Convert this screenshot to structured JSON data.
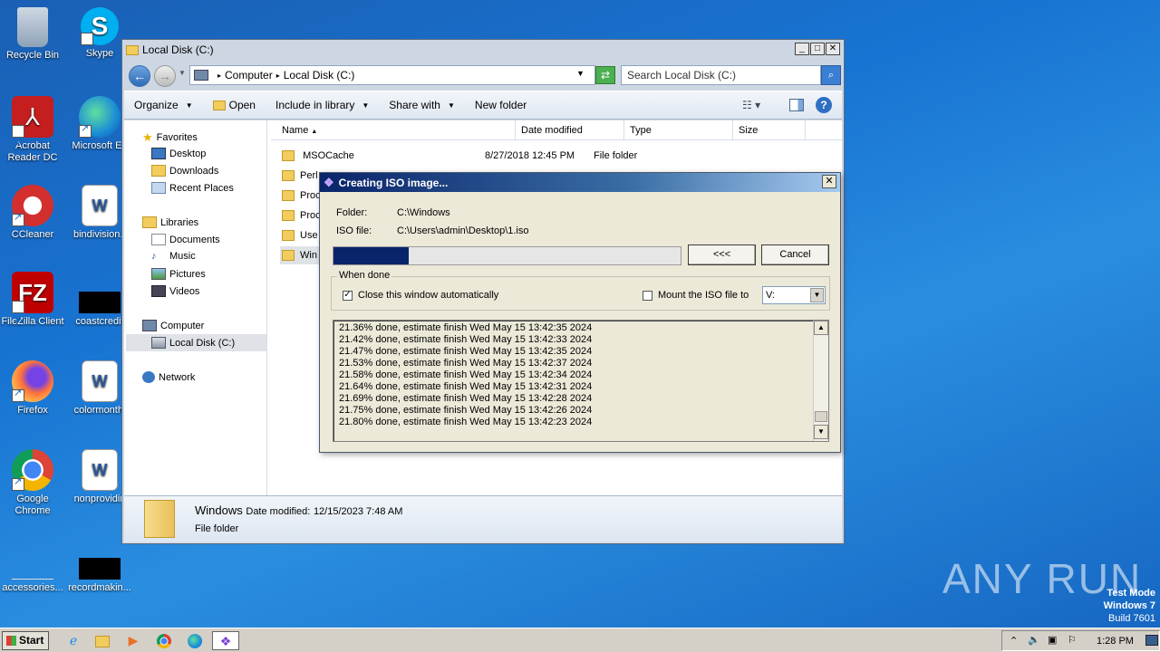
{
  "desktop": {
    "icons": [
      {
        "label": "Recycle Bin"
      },
      {
        "label": "Skype"
      },
      {
        "label": "Acrobat Reader DC"
      },
      {
        "label": "Microsoft Ed"
      },
      {
        "label": "CCleaner"
      },
      {
        "label": "bindivision.r"
      },
      {
        "label": "FileZilla Client"
      },
      {
        "label": "coastcredit"
      },
      {
        "label": "Firefox"
      },
      {
        "label": "colormonthl"
      },
      {
        "label": "Google Chrome"
      },
      {
        "label": "nonprovidin"
      },
      {
        "label": "accessories..."
      },
      {
        "label": "recordmakin..."
      }
    ],
    "watermark": "ANY RUN",
    "test_mode": {
      "line1": "Test Mode",
      "line2": "Windows 7",
      "line3": "Build 7601"
    }
  },
  "explorer": {
    "title": "Local Disk (C:)",
    "address": {
      "crumb1": "Computer",
      "crumb2": "Local Disk (C:)"
    },
    "search_placeholder": "Search Local Disk (C:)",
    "toolbar": {
      "organize": "Organize",
      "open": "Open",
      "include": "Include in library",
      "share": "Share with",
      "new_folder": "New folder"
    },
    "nav": {
      "favorites": "Favorites",
      "desktop": "Desktop",
      "downloads": "Downloads",
      "recent": "Recent Places",
      "libraries": "Libraries",
      "documents": "Documents",
      "music": "Music",
      "pictures": "Pictures",
      "videos": "Videos",
      "computer": "Computer",
      "local_disk": "Local Disk (C:)",
      "network": "Network"
    },
    "columns": {
      "name": "Name",
      "date": "Date modified",
      "type": "Type",
      "size": "Size"
    },
    "files": [
      {
        "name": "MSOCache",
        "date": "8/27/2018 12:45 PM",
        "type": "File folder"
      },
      {
        "name": "Perl"
      },
      {
        "name": "Proc"
      },
      {
        "name": "Proc"
      },
      {
        "name": "Use"
      },
      {
        "name": "Win"
      }
    ],
    "details": {
      "name": "Windows",
      "date_label": "Date modified:",
      "date": "12/15/2023 7:48 AM",
      "type": "File folder"
    }
  },
  "dialog": {
    "title": "Creating ISO image...",
    "folder_label": "Folder:",
    "folder_value": "C:\\Windows",
    "iso_label": "ISO file:",
    "iso_value": "C:\\Users\\admin\\Desktop\\1.iso",
    "progress_fraction": 0.218,
    "collapse_button": "<<<",
    "cancel_button": "Cancel",
    "when_done": "When done",
    "close_auto": "Close this window automatically",
    "mount_label": "Mount the ISO file to",
    "mount_drive": "V:",
    "log": [
      "21.36% done, estimate finish Wed May 15 13:42:35 2024",
      "21.42% done, estimate finish Wed May 15 13:42:33 2024",
      "21.47% done, estimate finish Wed May 15 13:42:35 2024",
      "21.53% done, estimate finish Wed May 15 13:42:37 2024",
      "21.58% done, estimate finish Wed May 15 13:42:34 2024",
      "21.64% done, estimate finish Wed May 15 13:42:31 2024",
      "21.69% done, estimate finish Wed May 15 13:42:28 2024",
      "21.75% done, estimate finish Wed May 15 13:42:26 2024",
      "21.80% done, estimate finish Wed May 15 13:42:23 2024"
    ]
  },
  "taskbar": {
    "start": "Start",
    "clock": "1:28 PM"
  }
}
